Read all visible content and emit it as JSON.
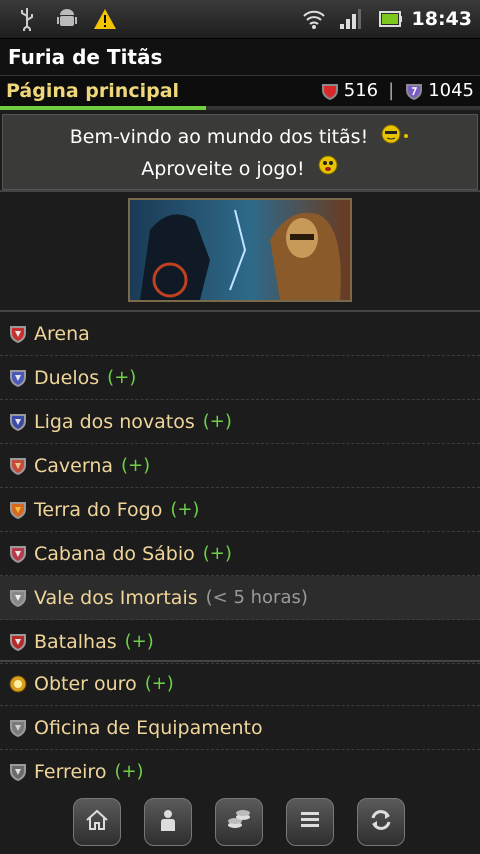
{
  "status_bar": {
    "time": "18:43",
    "icons": [
      "usb-icon",
      "android-icon",
      "warning-icon",
      "wifi-icon",
      "signal-icon",
      "battery-icon"
    ]
  },
  "app": {
    "title": "Furia de Titãs"
  },
  "header": {
    "page_title": "Página principal",
    "stat_red": "516",
    "separator": "|",
    "stat_purple": "1045",
    "progress": 0.43
  },
  "welcome": {
    "line1": "Bem-vindo ao mundo dos titãs!",
    "line2": "Aproveite o jogo!"
  },
  "menu_top": [
    {
      "label": "Arena",
      "extra": "",
      "icon": "arena-icon"
    },
    {
      "label": "Duelos",
      "extra": "(+)",
      "icon": "duel-shield-icon"
    },
    {
      "label": "Liga dos novatos",
      "extra": "(+)",
      "icon": "league-shield-icon"
    },
    {
      "label": "Caverna",
      "extra": "(+)",
      "icon": "cave-icon"
    },
    {
      "label": "Terra do Fogo",
      "extra": "(+)",
      "icon": "fire-land-icon"
    },
    {
      "label": "Cabana do Sábio",
      "extra": "(+)",
      "icon": "sage-hut-icon"
    },
    {
      "label": "Vale dos Imortais",
      "extra": "(< 5 horas)",
      "icon": "immortals-icon"
    },
    {
      "label": "Batalhas",
      "extra": "(+)",
      "icon": "battles-icon"
    }
  ],
  "menu_bottom": [
    {
      "label": "Obter ouro",
      "extra": "(+)",
      "icon": "gold-coin-icon"
    },
    {
      "label": "Oficina de Equipamento",
      "extra": "",
      "icon": "workshop-icon"
    },
    {
      "label": "Ferreiro",
      "extra": "(+)",
      "icon": "blacksmith-icon"
    }
  ],
  "bottom_nav": [
    "home-icon",
    "profile-icon",
    "coins-icon",
    "list-icon",
    "refresh-icon"
  ],
  "colors": {
    "accent_gold": "#f0d77a",
    "menu_label": "#f0d59a",
    "plus_green": "#6ed04a",
    "progress_green": "#6fcf3f"
  }
}
